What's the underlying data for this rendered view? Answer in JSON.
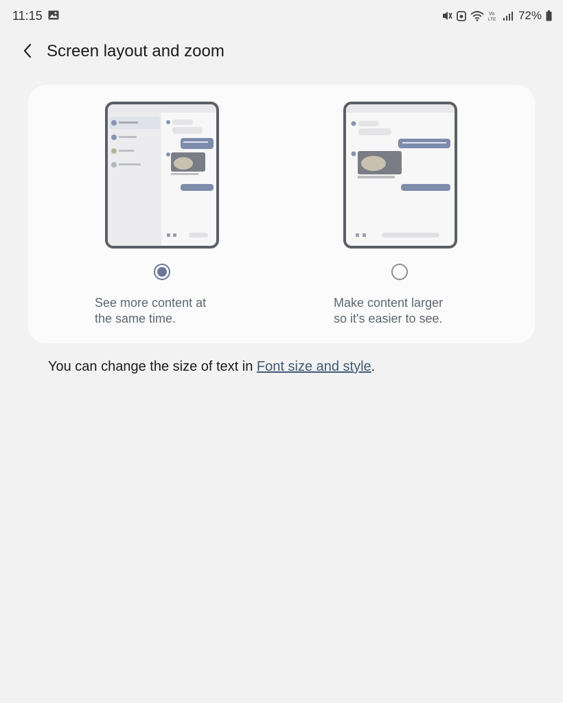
{
  "status_bar": {
    "time": "11:15",
    "battery_percent": "72%",
    "icons": [
      "image-icon",
      "mute-vibrate-icon",
      "alarm-icon",
      "wifi-icon",
      "volte-icon",
      "signal-icon",
      "battery-icon"
    ]
  },
  "app_bar": {
    "title": "Screen layout and zoom"
  },
  "options": [
    {
      "line1": "See more content at",
      "line2": "the same time.",
      "selected": true
    },
    {
      "line1": "Make content larger",
      "line2": "so it's easier to see.",
      "selected": false
    }
  ],
  "footnote": {
    "prefix": "You can change the size of text in ",
    "link": "Font size and style",
    "suffix": "."
  },
  "colors": {
    "background": "#f2f2f2",
    "card": "#fbfbfb",
    "accent": "#6c7896",
    "link": "#3f5a75"
  }
}
